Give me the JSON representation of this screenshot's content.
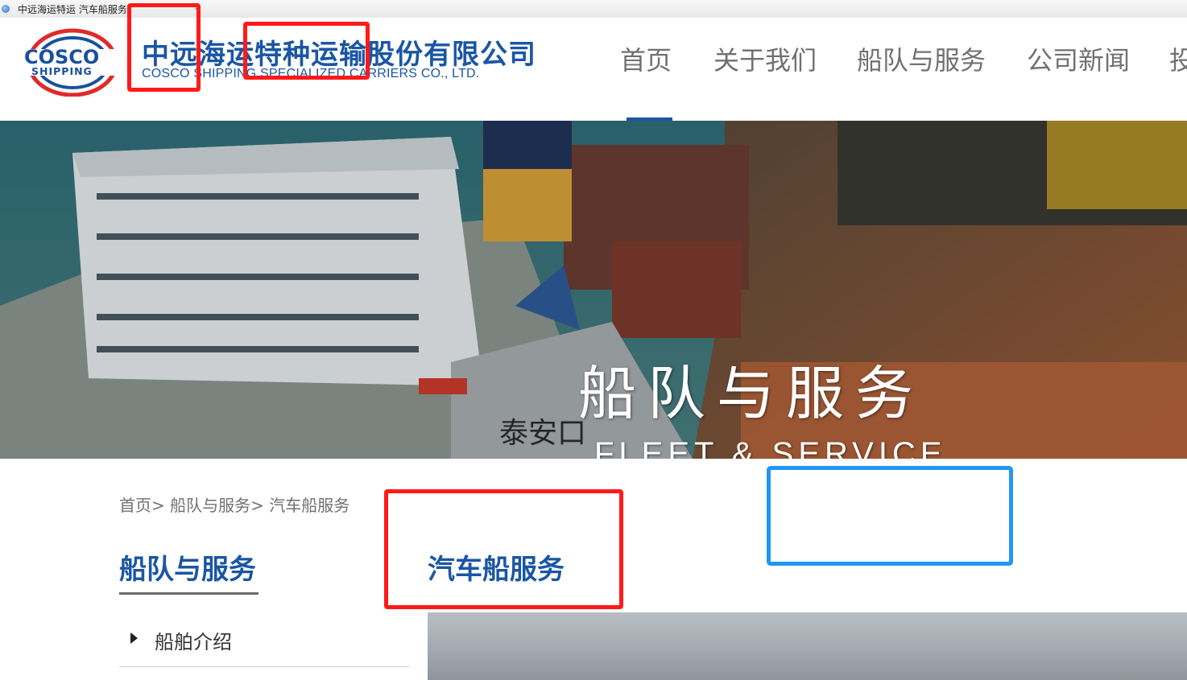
{
  "browser": {
    "tab_title": "中远海运特运 汽车船服务",
    "tab_close": "×"
  },
  "header": {
    "logo": {
      "text_top": "COSCO",
      "text_bottom": "SHIPPING",
      "colors": {
        "blue": "#1a4fa0",
        "red": "#e02a2a"
      }
    },
    "company_name_cn": "中远海运特种运输股份有限公司",
    "company_name_en": "COSCO SHIPPING SPECIALIZED CARRIERS CO., LTD.",
    "nav": [
      {
        "label": "首页",
        "active": true
      },
      {
        "label": "关于我们",
        "active": false
      },
      {
        "label": "船队与服务",
        "active": false
      },
      {
        "label": "公司新闻",
        "active": false
      },
      {
        "label": "投",
        "active": false
      }
    ]
  },
  "hero": {
    "title_cn": "船队与服务",
    "title_en": "FLEET & SERVICE",
    "ship_hull_text": "泰安口"
  },
  "breadcrumb": [
    {
      "label": "首页"
    },
    {
      "label": "船队与服务"
    },
    {
      "label": "汽车船服务"
    }
  ],
  "breadcrumb_separator": ">",
  "sidebar": {
    "title": "船队与服务",
    "items": [
      {
        "label": "船舶介绍"
      }
    ]
  },
  "main": {
    "title": "汽车船服务"
  },
  "colors": {
    "brand_blue": "#1a56a4",
    "annotation_red": "#ff1a1a",
    "annotation_blue": "#2196f3"
  }
}
